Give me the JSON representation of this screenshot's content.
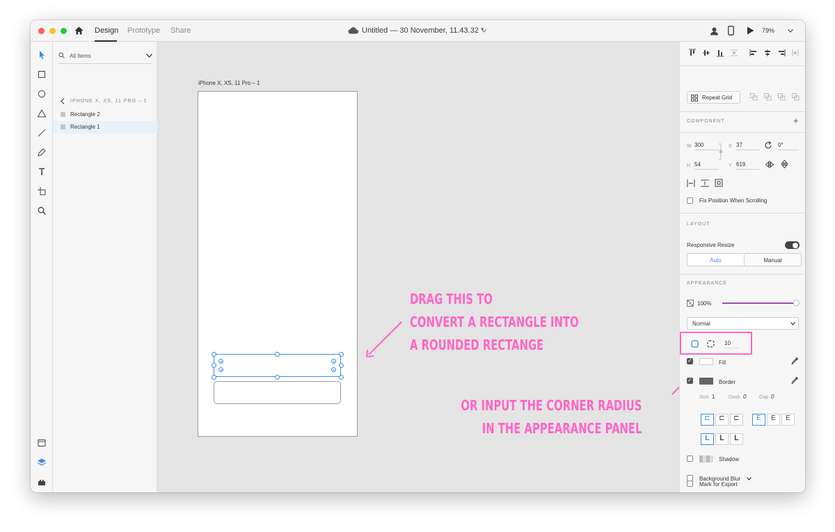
{
  "titlebar": {
    "tabs": [
      {
        "label": "Design",
        "active": true
      },
      {
        "label": "Prototype",
        "active": false
      },
      {
        "label": "Share",
        "active": false
      }
    ],
    "doc_title": "Untitled — 30 November, 11.43.32 *",
    "zoom": "79%"
  },
  "tools": [
    "select-icon",
    "rectangle-icon",
    "ellipse-icon",
    "polygon-icon",
    "line-icon",
    "pen-icon",
    "text-icon",
    "artboard-icon",
    "zoom-icon"
  ],
  "layers": {
    "filter": "All Items",
    "artboard": "IPHONE X, XS, 11 PRO – 1",
    "items": [
      {
        "label": "Rectangle 2",
        "selected": false
      },
      {
        "label": "Rectangle 1",
        "selected": true
      }
    ]
  },
  "canvas": {
    "artboard_title": "iPhone X, XS, 11 Pro – 1",
    "annotation_1": [
      "DRAG THIS TO",
      "CONVERT A RECTANGLE INTO",
      "A ROUNDED RECTANGE"
    ],
    "annotation_2": [
      "OR INPUT THE CORNER RADIUS",
      "IN THE APPEARANCE PANEL"
    ],
    "annotation_color": "#ff66c4"
  },
  "props": {
    "repeat_grid": "Repeat Grid",
    "component_label": "COMPONENT",
    "w_label": "W",
    "w": "300",
    "x_label": "X",
    "x": "37",
    "h_label": "H",
    "h": "54",
    "y_label": "Y",
    "y": "619",
    "rotation": "0°",
    "fix_position": "Fix Position When Scrolling",
    "layout_label": "LAYOUT",
    "responsive_resize": "Responsive Resize",
    "responsive_on": true,
    "auto": "Auto",
    "manual": "Manual",
    "appearance_label": "APPEARANCE",
    "opacity": "100%",
    "blend_mode": "Normal",
    "corner_radius": "10",
    "fill": "Fill",
    "border": "Border",
    "size_label": "Size",
    "size": "1",
    "dash_label": "Dash",
    "dash": "0",
    "gap_label": "Gap",
    "gap": "0",
    "shadow": "Shadow",
    "background_blur": "Background Blur",
    "mark_export": "Mark for Export",
    "accent": "#3b8de0"
  }
}
